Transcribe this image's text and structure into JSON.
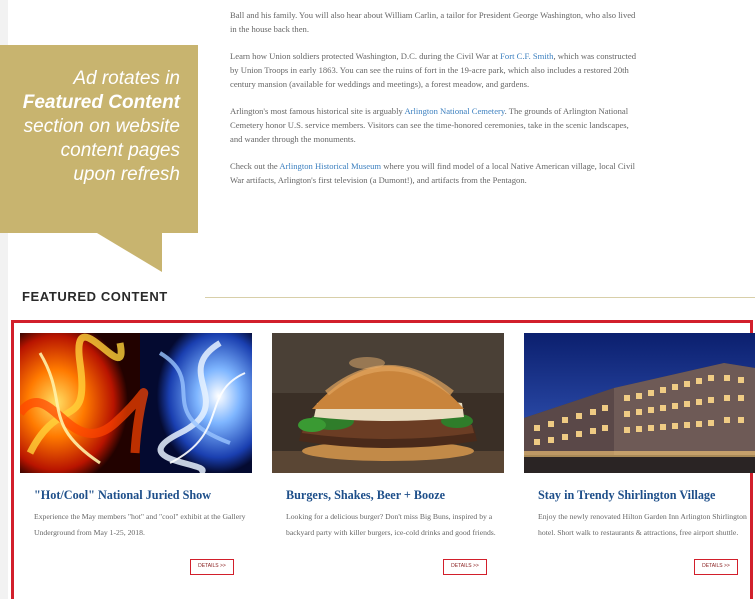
{
  "article": {
    "p1": "Ball and his family. You will also hear about William Carlin, a tailor for President George Washington, who also lived in the house back then.",
    "p2_before": "Learn how Union soldiers protected Washington, D.C. during the Civil War at ",
    "p2_link": "Fort C.F. Smith",
    "p2_after": ", which was constructed by Union Troops in early 1863. You can see the ruins of fort in the 19-acre park, which also includes a restored 20th century mansion (available for weddings and meetings), a forest meadow, and gardens.",
    "p3_before": "Arlington's most famous historical site is arguably ",
    "p3_link": "Arlington National Cemetery",
    "p3_after": ". The grounds of Arlington National Cemetery honor U.S. service members. Visitors can see the time-honored ceremonies, take in the scenic landscapes, and wander through the monuments.",
    "p4_before": "Check out the ",
    "p4_link": "Arlington Historical Museum",
    "p4_after": " where you will find model of a local Native American village, local Civil War artifacts, Arlington's first television (a Dumont!), and artifacts from the Pentagon."
  },
  "callout": {
    "line1": "Ad rotates in",
    "line2": "Featured Content",
    "line3": "section on website",
    "line4": "content pages",
    "line5": "upon refresh",
    "color": "#c8b46f"
  },
  "featured": {
    "header": "FEATURED CONTENT",
    "highlight_color": "#d21f2b",
    "cards": [
      {
        "title": "\"Hot/Cool\" National Juried Show",
        "desc": "Experience the May members \"hot\" and \"cool\" exhibit at the Gallery Underground from May 1-25, 2018.",
        "button": "DETAILS >>"
      },
      {
        "title": "Burgers, Shakes, Beer + Booze",
        "desc": "Looking for a delicious burger? Don't miss Big Buns, inspired by a backyard party with killer burgers, ice-cold drinks and good friends.",
        "button": "DETAILS >>"
      },
      {
        "title": "Stay in Trendy Shirlington Village",
        "desc": "Enjoy the newly renovated Hilton Garden Inn Arlington Shirlington hotel. Short walk to restaurants & attractions, free airport shuttle.",
        "button": "DETAILS >>"
      }
    ]
  }
}
